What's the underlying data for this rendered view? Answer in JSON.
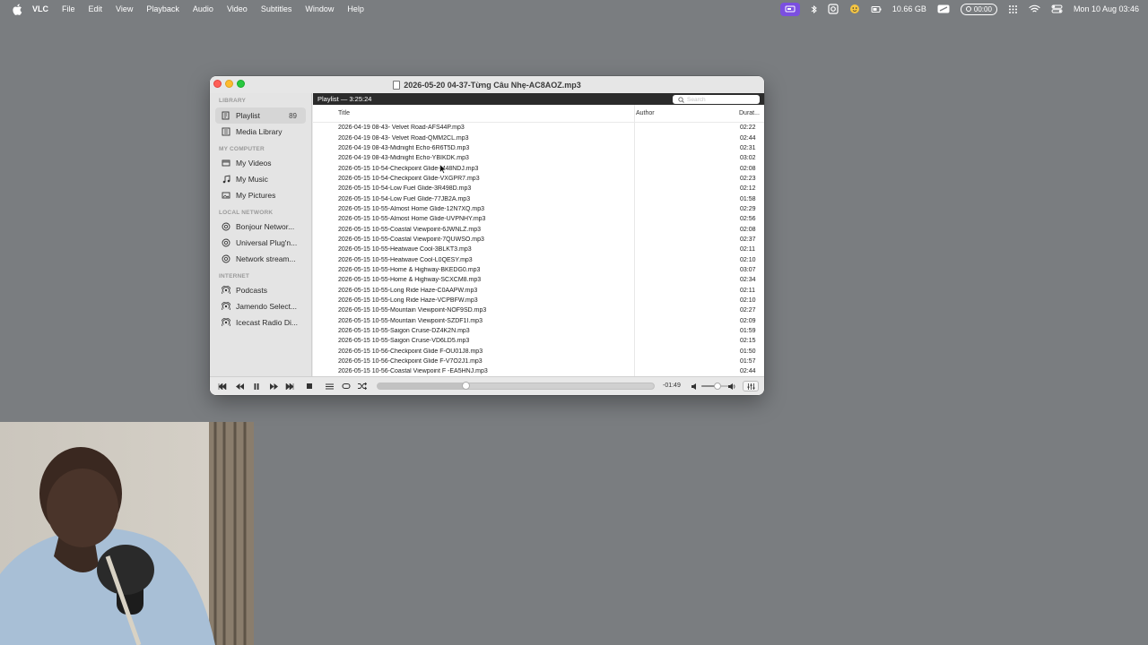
{
  "menubar": {
    "app_name": "VLC",
    "items": [
      "File",
      "Edit",
      "View",
      "Playback",
      "Audio",
      "Video",
      "Subtitles",
      "Window",
      "Help"
    ],
    "status": {
      "storage": "10.66 GB",
      "recording_time": "00:00",
      "datetime": "Mon 10 Aug  03:46"
    }
  },
  "window": {
    "title": "2026-05-20 04-37-Từng Câu Nhẹ-AC8AOZ.mp3"
  },
  "sidebar": {
    "sections": [
      {
        "header": "LIBRARY",
        "items": [
          {
            "label": "Playlist",
            "icon": "playlist-icon",
            "badge": "89",
            "selected": true
          },
          {
            "label": "Media Library",
            "icon": "media-library-icon"
          }
        ]
      },
      {
        "header": "MY COMPUTER",
        "items": [
          {
            "label": "My Videos",
            "icon": "videos-icon"
          },
          {
            "label": "My Music",
            "icon": "music-icon"
          },
          {
            "label": "My Pictures",
            "icon": "pictures-icon"
          }
        ]
      },
      {
        "header": "LOCAL NETWORK",
        "items": [
          {
            "label": "Bonjour Networ...",
            "icon": "network-icon"
          },
          {
            "label": "Universal Plug'n...",
            "icon": "network-icon"
          },
          {
            "label": "Network stream...",
            "icon": "network-icon"
          }
        ]
      },
      {
        "header": "INTERNET",
        "items": [
          {
            "label": "Podcasts",
            "icon": "podcast-icon"
          },
          {
            "label": "Jamendo Select...",
            "icon": "podcast-icon"
          },
          {
            "label": "Icecast Radio Di...",
            "icon": "podcast-icon"
          }
        ]
      }
    ]
  },
  "playlist": {
    "header": "Playlist — 3:25:24",
    "search_placeholder": "Search",
    "columns": {
      "title": "Title",
      "author": "Author",
      "duration": "Durat..."
    },
    "rows": [
      {
        "title": "2026-04-19 08-43- Velvet Road-AFS44P.mp3",
        "duration": "02:22"
      },
      {
        "title": "2026-04-19 08-43- Velvet Road-QMM2CL.mp3",
        "duration": "02:44"
      },
      {
        "title": "2026-04-19 08-43-Midnight Echo-6R6T5D.mp3",
        "duration": "02:31"
      },
      {
        "title": "2026-04-19 08-43-Midnight Echo-YBIKDK.mp3",
        "duration": "03:02"
      },
      {
        "title": "2026-05-15 10-54-Checkpoint Glide-M48NDJ.mp3",
        "duration": "02:08"
      },
      {
        "title": "2026-05-15 10-54-Checkpoint Glide-VXGPR7.mp3",
        "duration": "02:23"
      },
      {
        "title": "2026-05-15 10-54-Low Fuel Glide-3R498D.mp3",
        "duration": "02:12"
      },
      {
        "title": "2026-05-15 10-54-Low Fuel Glide-77JB2A.mp3",
        "duration": "01:58"
      },
      {
        "title": "2026-05-15 10-55-Almost Home Glide-12N7XQ.mp3",
        "duration": "02:29"
      },
      {
        "title": "2026-05-15 10-55-Almost Home Glide-UVPNHY.mp3",
        "duration": "02:56"
      },
      {
        "title": "2026-05-15 10-55-Coastal Viewpoint-6JWNLZ.mp3",
        "duration": "02:08"
      },
      {
        "title": "2026-05-15 10-55-Coastal Viewpoint-7QUWSO.mp3",
        "duration": "02:37"
      },
      {
        "title": "2026-05-15 10-55-Heatwave Cool-3BLKT3.mp3",
        "duration": "02:11"
      },
      {
        "title": "2026-05-15 10-55-Heatwave Cool-L0QESY.mp3",
        "duration": "02:10"
      },
      {
        "title": "2026-05-15 10-55-Home & Highway-BKEDG0.mp3",
        "duration": "03:07"
      },
      {
        "title": "2026-05-15 10-55-Home & Highway-SCXCM8.mp3",
        "duration": "02:34"
      },
      {
        "title": "2026-05-15 10-55-Long Ride Haze-C0AAPW.mp3",
        "duration": "02:11"
      },
      {
        "title": "2026-05-15 10-55-Long Ride Haze-VCPBFW.mp3",
        "duration": "02:10"
      },
      {
        "title": "2026-05-15 10-55-Mountain Viewpoint-NOF9SD.mp3",
        "duration": "02:27"
      },
      {
        "title": "2026-05-15 10-55-Mountain Viewpoint-SZDF1I.mp3",
        "duration": "02:09"
      },
      {
        "title": "2026-05-15 10-55-Saigon Cruise-DZ4K2N.mp3",
        "duration": "01:59"
      },
      {
        "title": "2026-05-15 10-55-Saigon Cruise-VD6LD5.mp3",
        "duration": "02:15"
      },
      {
        "title": "2026-05-15 10-56-Checkpoint Glide F-OU01J8.mp3",
        "duration": "01:50"
      },
      {
        "title": "2026-05-15 10-56-Checkpoint Glide F-V7O2J1.mp3",
        "duration": "01:57"
      },
      {
        "title": "2026-05-15 10-56-Coastal Viewpoint F -EA5HNJ.mp3",
        "duration": "02:44"
      }
    ]
  },
  "controls": {
    "time_remaining": "-01:49",
    "progress_fraction": 0.32,
    "volume_fraction": 0.5
  }
}
